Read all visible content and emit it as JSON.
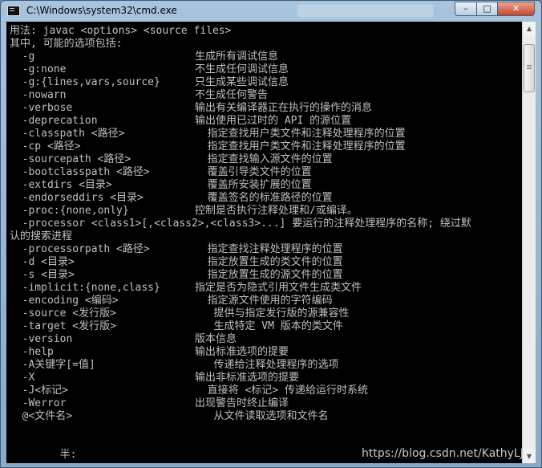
{
  "window": {
    "title": "C:\\Windows\\system32\\cmd.exe",
    "controls": {
      "minimize": "–",
      "maximize": "□",
      "close": "✕"
    }
  },
  "console": {
    "lines": [
      {
        "cmd": "用法: javac <options> <source files>",
        "desc": ""
      },
      {
        "cmd": "其中, 可能的选项包括:",
        "desc": ""
      },
      {
        "cmd": "  -g",
        "desc": "生成所有调试信息"
      },
      {
        "cmd": "  -g:none",
        "desc": "不生成任何调试信息"
      },
      {
        "cmd": "  -g:{lines,vars,source}",
        "desc": "只生成某些调试信息"
      },
      {
        "cmd": "  -nowarn",
        "desc": "不生成任何警告"
      },
      {
        "cmd": "  -verbose",
        "desc": "输出有关编译器正在执行的操作的消息"
      },
      {
        "cmd": "  -deprecation",
        "desc": "输出使用已过时的 API 的源位置"
      },
      {
        "cmd": "  -classpath <路径>",
        "desc": "  指定查找用户类文件和注释处理程序的位置"
      },
      {
        "cmd": "  -cp <路径>",
        "desc": "  指定查找用户类文件和注释处理程序的位置"
      },
      {
        "cmd": "  -sourcepath <路径>",
        "desc": "  指定查找输入源文件的位置"
      },
      {
        "cmd": "  -bootclasspath <路径>",
        "desc": "  覆盖引导类文件的位置"
      },
      {
        "cmd": "  -extdirs <目录>",
        "desc": "  覆盖所安装扩展的位置"
      },
      {
        "cmd": "  -endorseddirs <目录>",
        "desc": "  覆盖签名的标准路径的位置"
      },
      {
        "cmd": "  -proc:{none,only}",
        "desc": "控制是否执行注释处理和/或编译。"
      },
      {
        "cmd": "  -processor <class1>[,<class2>,<class3>...] 要运行的注释处理程序的名称; 绕过默",
        "desc": ""
      },
      {
        "cmd": "认的搜索进程",
        "desc": ""
      },
      {
        "cmd": "  -processorpath <路径>",
        "desc": "  指定查找注释处理程序的位置"
      },
      {
        "cmd": "  -d <目录>",
        "desc": "  指定放置生成的类文件的位置"
      },
      {
        "cmd": "  -s <目录>",
        "desc": "  指定放置生成的源文件的位置"
      },
      {
        "cmd": "  -implicit:{none,class}",
        "desc": "指定是否为隐式引用文件生成类文件"
      },
      {
        "cmd": "  -encoding <编码>",
        "desc": "  指定源文件使用的字符编码"
      },
      {
        "cmd": "  -source <发行版>",
        "desc": "   提供与指定发行版的源兼容性"
      },
      {
        "cmd": "  -target <发行版>",
        "desc": "   生成特定 VM 版本的类文件"
      },
      {
        "cmd": "  -version",
        "desc": "版本信息"
      },
      {
        "cmd": "  -help",
        "desc": "输出标准选项的提要"
      },
      {
        "cmd": "  -A关键字[=值]",
        "desc": "   传递给注释处理程序的选项"
      },
      {
        "cmd": "  -X",
        "desc": "输出非标准选项的提要"
      },
      {
        "cmd": "  -J<标记>",
        "desc": "  直接将 <标记> 传递给运行时系统"
      },
      {
        "cmd": "  -Werror",
        "desc": "出现警告时终止编译"
      },
      {
        "cmd": "  @<文件名>",
        "desc": "   从文件读取选项和文件名"
      },
      {
        "cmd": "",
        "desc": ""
      },
      {
        "cmd": "",
        "desc": ""
      },
      {
        "cmd": "        半:",
        "desc": ""
      }
    ]
  },
  "watermark": "https://blog.csdn.net/KathyLJ"
}
